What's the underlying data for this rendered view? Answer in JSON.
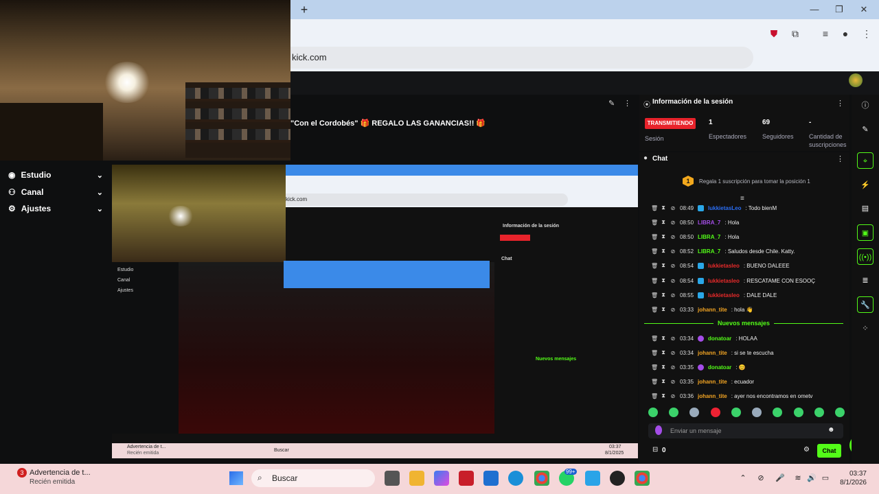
{
  "browser": {
    "new_tab": "+",
    "url": "kick.com",
    "window_controls": {
      "minimize": "—",
      "maximize": "❐",
      "close": "✕"
    }
  },
  "stream": {
    "title": "\"Con el Cordobés\" 🎁 REGALO LAS GANANCIAS!! 🎁"
  },
  "sidebar": {
    "items": [
      {
        "label": "Estudio",
        "icon": "studio-icon"
      },
      {
        "label": "Canal",
        "icon": "channel-icon"
      },
      {
        "label": "Ajustes",
        "icon": "settings-gear-icon"
      }
    ]
  },
  "session": {
    "title": "Información de la sesión",
    "status": "TRANSMITIENDO",
    "session_label": "Sesión",
    "stats": [
      {
        "value": "1",
        "label": "Espectadores"
      },
      {
        "value": "69",
        "label": "Seguidores"
      },
      {
        "value": "-",
        "label": "Cantidad de suscripciones"
      }
    ]
  },
  "chat": {
    "title": "Chat",
    "sub_badge": "1",
    "sub_info": "Regala 1 suscripción para tomar la posición 1",
    "new_messages_label": "Nuevos mensajes",
    "messages": [
      {
        "time": "08:49",
        "user": "lukkietasLeo",
        "user_color": "#2a6ef5",
        "text": ": Todo bienM"
      },
      {
        "time": "08:50",
        "user": "LIBRA_7",
        "user_color": "#a44de8",
        "text": ": Hola"
      },
      {
        "time": "08:50",
        "user": "LIBRA_7",
        "user_color": "#53fc18",
        "text": ": Hola"
      },
      {
        "time": "08:52",
        "user": "LIBRA_7",
        "user_color": "#53fc18",
        "text": ": Saludos desde Chile. Katty."
      },
      {
        "time": "08:54",
        "user": "lukkietasleo",
        "user_color": "#e82a2a",
        "text": ": BUENO DALEEE"
      },
      {
        "time": "08:54",
        "user": "lukkietasleo",
        "user_color": "#e82a2a",
        "text": ": RESCATAME CON ESOOÇ"
      },
      {
        "time": "08:55",
        "user": "lukkietasleo",
        "user_color": "#e82a2a",
        "text": ": DALE DALE"
      },
      {
        "time": "03:33",
        "user": "johann_tite",
        "user_color": "#f5a623",
        "text": ": hola 👋"
      }
    ],
    "new_messages": [
      {
        "time": "03:34",
        "user": "donatoar",
        "user_color": "#53fc18",
        "text": ": HOLAA"
      },
      {
        "time": "03:34",
        "user": "johann_tite",
        "user_color": "#f5a623",
        "text": ": si se te escucha"
      },
      {
        "time": "03:35",
        "user": "donatoar",
        "user_color": "#53fc18",
        "text": ": 😊"
      },
      {
        "time": "03:35",
        "user": "johann_tite",
        "user_color": "#f5a623",
        "text": ": ecuador"
      },
      {
        "time": "03:36",
        "user": "johann_tite",
        "user_color": "#f5a623",
        "text": ": ayer nos encontramos en ometv"
      }
    ],
    "input_placeholder": "Enviar un mensaje",
    "viewers_count": "0",
    "send_label": "Chat"
  },
  "nested": {
    "url": "kick.com",
    "session_title": "Información de la sesión",
    "chat_title": "Chat",
    "new_messages_label": "Nuevos mensajes",
    "clock_time": "03:37",
    "clock_date": "8/1/2025",
    "notif_title": "Advertencia de t...",
    "notif_sub": "Recién emitida",
    "search": "Buscar",
    "sidebar": [
      "Estudio",
      "Canal",
      "Ajustes"
    ]
  },
  "taskbar": {
    "notif_badge": "3",
    "notif_title": "Advertencia de t...",
    "notif_sub": "Recién emitida",
    "search_placeholder": "Buscar",
    "badge_99": "99+",
    "clock_time": "03:37",
    "clock_date": "8/1/2026"
  },
  "colors": {
    "accent": "#53fc18",
    "live": "#e8232b",
    "background": "#0e0f10",
    "panel": "#111111"
  }
}
